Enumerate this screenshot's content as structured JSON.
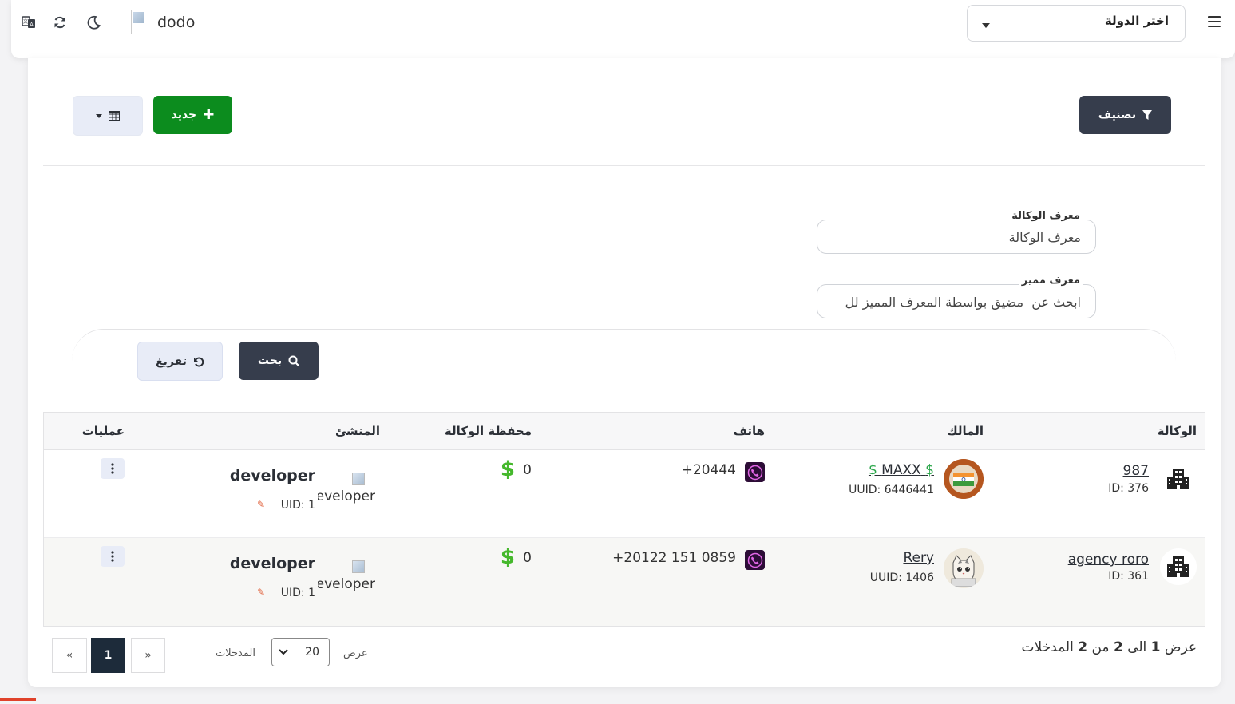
{
  "navbar": {
    "brand_name": "dodo",
    "country_select_label": "اختر الدولة"
  },
  "toolbar": {
    "filter_label": "تصنيف",
    "new_label": "جديد"
  },
  "filters": {
    "agency_id_label": "معرف الوكالة",
    "agency_id_placeholder": "معرف الوكالة",
    "unique_id_label": "معرف مميز",
    "unique_id_placeholder": "ابحث عن  مضيق بواسطة المعرف المميز لل",
    "search_label": "بحث",
    "reset_label": "تفريغ"
  },
  "table": {
    "headers": {
      "agency": "الوكالة",
      "owner": "المالك",
      "phone": "هاتف",
      "wallet": "محفظة الوكالة",
      "creator": "المنشئ",
      "actions": "عمليات"
    },
    "rows": [
      {
        "agency_name": "987",
        "agency_id": "ID: 376",
        "owner_name": "MAXX",
        "owner_uuid": "UUID: 6446441",
        "owner_flag": "india-flag",
        "phone": "+20444",
        "wallet": "0",
        "creator_alt": "developer",
        "creator_name": "developer",
        "creator_uid": "UID: 1"
      },
      {
        "agency_name": "agency roro",
        "agency_id": "ID: 361",
        "owner_name": "Rery",
        "owner_uuid": "UUID: 1406",
        "owner_flag": "cat-avatar",
        "phone": "+20122 151 0859",
        "wallet": "0",
        "creator_alt": "developer",
        "creator_name": "developer",
        "creator_uid": "UID: 1"
      }
    ]
  },
  "footer": {
    "info_prefix": "عرض",
    "info_from": "1",
    "info_mid": "الى",
    "info_to": "2",
    "info_of": "من",
    "info_total": "2",
    "info_suffix": "المدخلات",
    "show_label": "عرض",
    "per_page": "20",
    "entries_label": "المدخلات",
    "current_page": "1",
    "prev_label": "«",
    "next_label": "»"
  },
  "colors": {
    "dark_button": "#363d4c",
    "green_button": "#0c8c1e",
    "money_green": "#45b82c",
    "light_button": "#e8ecf7"
  }
}
